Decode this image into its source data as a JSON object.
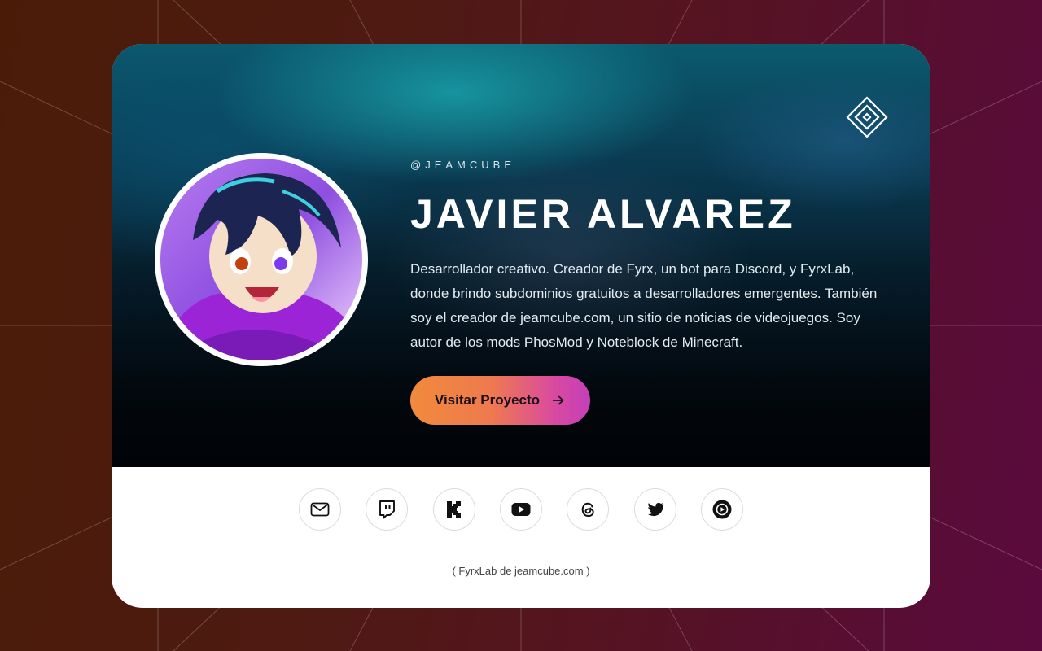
{
  "profile": {
    "handle": "@JEAMCUBE",
    "name": "JAVIER ALVAREZ",
    "bio": "Desarrollador creativo. Creador de Fyrx, un bot para Discord, y FyrxLab, donde brindo subdominios gratuitos a desarrolladores emergentes. También soy el creador de jeamcube.com, un sitio de noticias de videojuegos. Soy autor de los mods PhosMod y Noteblock de Minecraft."
  },
  "cta": {
    "label": "Visitar Proyecto",
    "icon": "arrow-right-icon"
  },
  "social": [
    {
      "icon": "mail-icon"
    },
    {
      "icon": "twitch-icon"
    },
    {
      "icon": "kick-icon"
    },
    {
      "icon": "youtube-icon"
    },
    {
      "icon": "threads-icon"
    },
    {
      "icon": "twitter-icon"
    },
    {
      "icon": "play-circle-icon"
    }
  ],
  "footer": {
    "text": "( FyrxLab de jeamcube.com )"
  },
  "colors": {
    "background_start": "#4a1c08",
    "background_end": "#5a0a3e",
    "accent_start": "#f08a3c",
    "accent_end": "#c43fb8",
    "card": "#ffffff"
  }
}
